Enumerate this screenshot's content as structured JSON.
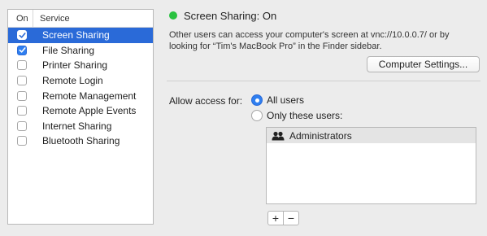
{
  "service_list": {
    "header_on": "On",
    "header_service": "Service",
    "items": [
      {
        "label": "Screen Sharing",
        "checked": true,
        "selected": true
      },
      {
        "label": "File Sharing",
        "checked": true,
        "selected": false
      },
      {
        "label": "Printer Sharing",
        "checked": false,
        "selected": false
      },
      {
        "label": "Remote Login",
        "checked": false,
        "selected": false
      },
      {
        "label": "Remote Management",
        "checked": false,
        "selected": false
      },
      {
        "label": "Remote Apple Events",
        "checked": false,
        "selected": false
      },
      {
        "label": "Internet Sharing",
        "checked": false,
        "selected": false
      },
      {
        "label": "Bluetooth Sharing",
        "checked": false,
        "selected": false
      }
    ]
  },
  "status": {
    "title": "Screen Sharing: On",
    "indicator_color": "#29c240"
  },
  "description": "Other users can access your computer's screen at vnc://10.0.0.7/ or by looking for “Tim's MacBook Pro” in the Finder sidebar.",
  "computer_settings_button": "Computer Settings...",
  "access": {
    "label": "Allow access for:",
    "options": [
      {
        "label": "All users",
        "selected": true
      },
      {
        "label": "Only these users:",
        "selected": false
      }
    ]
  },
  "users": [
    {
      "name": "Administrators",
      "icon": "group-icon"
    }
  ],
  "buttons": {
    "add": "+",
    "remove": "−"
  },
  "colors": {
    "selection": "#2a6ad8",
    "accent": "#2f7ff0"
  }
}
